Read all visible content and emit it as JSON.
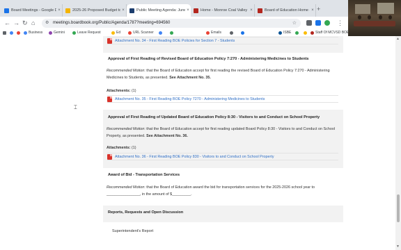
{
  "browser": {
    "tabs": [
      {
        "title": "Board Meetings - Google Drive",
        "color": "#1a73e8"
      },
      {
        "title": "2025-26 Proposed Budget to...",
        "color": "#f4b400"
      },
      {
        "title": "Public Meeting Agenda: June 1...",
        "color": "#1c3d6e"
      },
      {
        "title": "Home - Monroe Coal Valley Sch...",
        "color": "#b3261e"
      },
      {
        "title": "Board of Education Home - Mo...",
        "color": "#b3261e"
      }
    ],
    "new_tab": "+",
    "url": "meetings.boardbook.org/Public/Agenda/1787?meeting=694560",
    "bookmarks": [
      {
        "label": "Business",
        "color": "#4285f4"
      },
      {
        "label": "Gemini",
        "color": "#8e44ad"
      },
      {
        "label": "Leave Request",
        "color": "#34a853"
      },
      {
        "label": "Ed",
        "color": "#fbbc05"
      },
      {
        "label": "URL Scanner",
        "color": "#ea4335"
      },
      {
        "label": "",
        "color": "#4285f4"
      },
      {
        "label": "",
        "color": "#34a853"
      },
      {
        "label": "Emails",
        "color": "#ea4335"
      },
      {
        "label": "",
        "color": "#5f6368"
      },
      {
        "label": "",
        "color": "#1a73e8"
      },
      {
        "label": "ISBE",
        "color": "#0b5394"
      },
      {
        "label": "",
        "color": "#34a853"
      },
      {
        "label": "",
        "color": "#fbbc05"
      },
      {
        "label": "Staff Of MCVSD BOE",
        "color": "#b3261e"
      }
    ]
  },
  "agenda": {
    "top_attachment": "Attachment No. 34 - First Reading BOE Policies for Section 7 - Students",
    "items": [
      {
        "title": "Approval of First Reading of Revised Board of Education Policy 7:270 - Administering Medicines to Students",
        "motion_label": "Recommended Motion",
        "motion_text": ": that the Board of Education accept for first reading the revised Board of Education Policy 7:270 - Administering Medicines to Students, as presented. ",
        "motion_bold": "See Attachment No. 35.",
        "attachments_label": "Attachments:",
        "attachments_count": "(1)",
        "attachment": "Attachment No. 35 - First Reading BOE Policy 7270 - Administering Medicines to Students"
      },
      {
        "title": "Approval of First Reading of Updated Board of Education Policy 8:30 - Visitors to and Conduct on School Property",
        "motion_label": "Recommended Motion",
        "motion_text": ": that the Board of Education accept for first reading updated Board Policy 8:30 - Visitors to and Conduct on School Property, as presented. ",
        "motion_bold": "See Attachment No. 36.",
        "attachments_label": "Attachments:",
        "attachments_count": "(1)",
        "attachment": "Attachment No. 36 - First Reading BOE Policy 830 - Visitors to and Conduct on School Property"
      },
      {
        "title": "Award of Bid - Transportation Services",
        "motion_label": "Recommended Motion",
        "motion_text": ": that the Board of Education award the bid for transportation services for the 2025-2026 school year to ________________, in the amount of $_________."
      }
    ],
    "section_title": "Reports, Requests and Open Discussion",
    "sub_item": "Superintendent's Report"
  }
}
